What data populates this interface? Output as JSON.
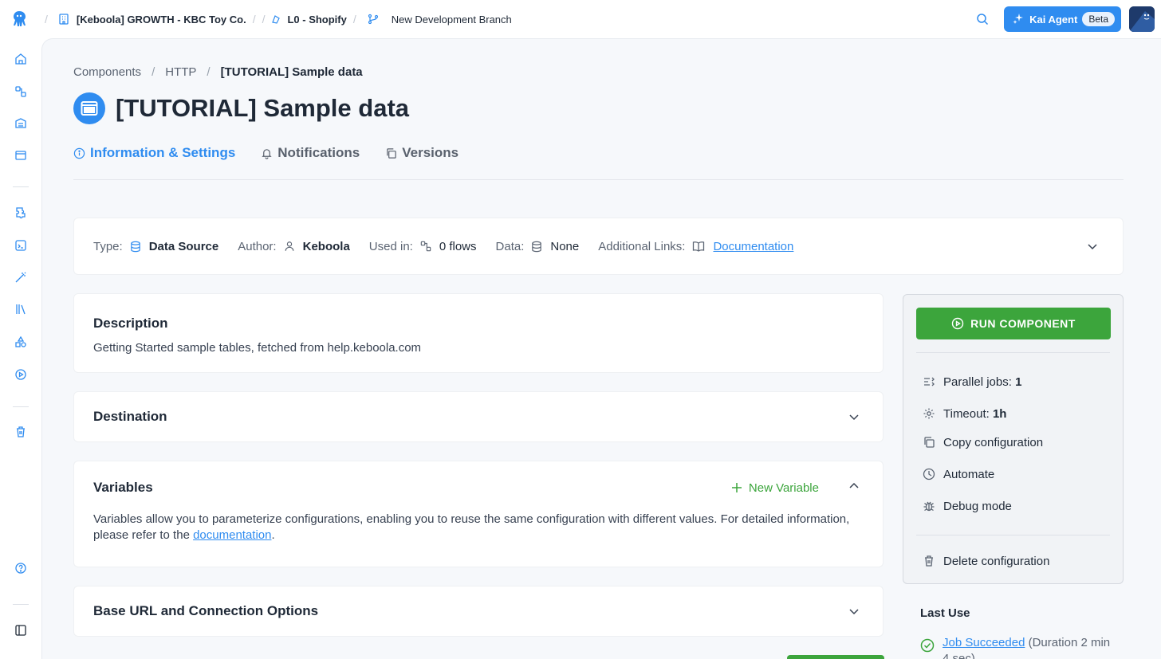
{
  "topbar": {
    "project": "[Keboola] GROWTH - KBC Toy Co.",
    "config": "L0 - Shopify",
    "branch": "New Development Branch",
    "kai_label": "Kai Agent",
    "kai_badge": "Beta"
  },
  "breadcrumb": {
    "items": [
      "Components",
      "HTTP"
    ],
    "current": "[TUTORIAL] Sample data"
  },
  "page": {
    "title": "[TUTORIAL] Sample data"
  },
  "tabs": [
    {
      "label": "Information & Settings",
      "active": true
    },
    {
      "label": "Notifications",
      "active": false
    },
    {
      "label": "Versions",
      "active": false
    }
  ],
  "info": {
    "type_label": "Type:",
    "type_value": "Data Source",
    "author_label": "Author:",
    "author_value": "Keboola",
    "used_label": "Used in:",
    "used_value": "0 flows",
    "data_label": "Data:",
    "data_value": "None",
    "links_label": "Additional Links:",
    "links_value": "Documentation"
  },
  "description": {
    "title": "Description",
    "text": "Getting Started sample tables, fetched from help.keboola.com"
  },
  "destination": {
    "title": "Destination"
  },
  "variables": {
    "title": "Variables",
    "new_label": "New Variable",
    "text_before": "Variables allow you to parameterize configurations, enabling you to reuse the same configuration with different values. For detailed information, please refer to the ",
    "link": "documentation",
    "text_after": "."
  },
  "base_url": {
    "title": "Base URL and Connection Options"
  },
  "panel": {
    "run_label": "RUN COMPONENT",
    "parallel_label": "Parallel jobs:",
    "parallel_value": "1",
    "timeout_label": "Timeout:",
    "timeout_value": "1h",
    "copy_label": "Copy configuration",
    "automate_label": "Automate",
    "debug_label": "Debug mode",
    "delete_label": "Delete configuration"
  },
  "last_use": {
    "title": "Last Use",
    "job_link": "Job Succeeded",
    "job_detail": "(Duration 2 min 4 sec)"
  },
  "colors": {
    "accent": "#2f8cf0",
    "success": "#3ca53c"
  }
}
